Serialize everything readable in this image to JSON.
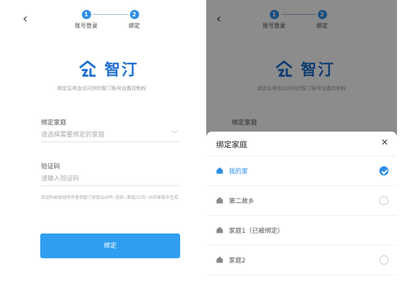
{
  "steps": [
    {
      "num": "1",
      "label": "账号登录"
    },
    {
      "num": "2",
      "label": "绑定"
    }
  ],
  "brand": {
    "name": "智汀",
    "subtitle": "绑定后将会访问你的智汀账号设备控制权"
  },
  "form": {
    "family_label": "绑定家庭",
    "family_placeholder": "请选择需要绑定的家庭",
    "code_label": "验证码",
    "code_placeholder": "请输入验证码",
    "hint": "验证码由家庭所有者到智汀家庭云APP--我的--家庭/公司--对应家庭中生成",
    "bind_button": "绑定"
  },
  "sheet": {
    "title": "绑定家庭",
    "close": "×",
    "items": [
      {
        "name": "我的家",
        "selected": true
      },
      {
        "name": "第二故乡",
        "selected": false
      },
      {
        "name": "家庭1（已被绑定）",
        "selected": false,
        "disabled": true
      },
      {
        "name": "家庭2",
        "selected": false
      }
    ]
  },
  "icons": {
    "back": "chevron-left-icon",
    "dropdown": "chevron-down-icon",
    "home": "home-icon",
    "check": "check-icon"
  },
  "colors": {
    "accent": "#2f8ee8",
    "button": "#2f9ef0",
    "brand": "#1e6fd1"
  }
}
